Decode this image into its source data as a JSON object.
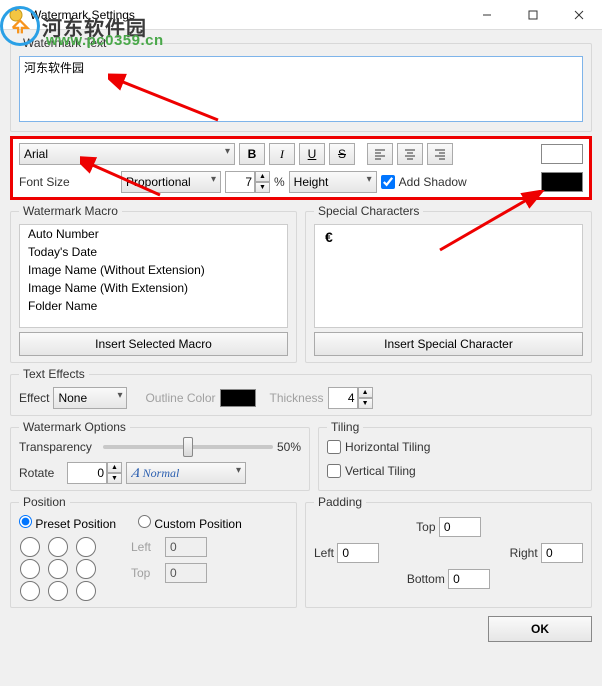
{
  "window": {
    "title": "Watermark Settings"
  },
  "watermark_text": {
    "legend": "Watermark Text",
    "value": "河东软件园"
  },
  "toolbar": {
    "font_family": "Arial",
    "font_size_label": "Font Size",
    "size_mode": "Proportional",
    "size_value": "7",
    "size_unit": "%",
    "size_relative": "Height",
    "add_shadow_label": "Add Shadow",
    "add_shadow_checked": true,
    "text_color": "#ffffff",
    "shadow_color": "#000000"
  },
  "macro": {
    "legend": "Watermark Macro",
    "items": [
      "Auto Number",
      "Today's Date",
      "Image Name (Without Extension)",
      "Image Name (With Extension)",
      "Folder Name"
    ],
    "button": "Insert Selected Macro"
  },
  "special": {
    "legend": "Special Characters",
    "content": "€",
    "button": "Insert Special Character"
  },
  "effects": {
    "legend": "Text Effects",
    "effect_label": "Effect",
    "effect_value": "None",
    "outline_label": "Outline Color",
    "outline_color": "#000000",
    "thickness_label": "Thickness",
    "thickness_value": "4"
  },
  "options": {
    "legend": "Watermark Options",
    "transparency_label": "Transparency",
    "transparency_value": "50%",
    "rotate_label": "Rotate",
    "rotate_value": "0",
    "style_value": "Normal"
  },
  "tiling": {
    "legend": "Tiling",
    "horizontal": "Horizontal Tiling",
    "vertical": "Vertical Tiling"
  },
  "position": {
    "legend": "Position",
    "preset": "Preset Position",
    "custom": "Custom Position",
    "left": "Left",
    "top": "Top",
    "left_value": "0",
    "top_value": "0"
  },
  "padding": {
    "legend": "Padding",
    "top": "Top",
    "left": "Left",
    "right": "Right",
    "bottom": "Bottom",
    "top_v": "0",
    "left_v": "0",
    "right_v": "0",
    "bottom_v": "0"
  },
  "ok": "OK",
  "overlay": {
    "brand": "河东软件园",
    "url": "www.pc0359.cn"
  }
}
